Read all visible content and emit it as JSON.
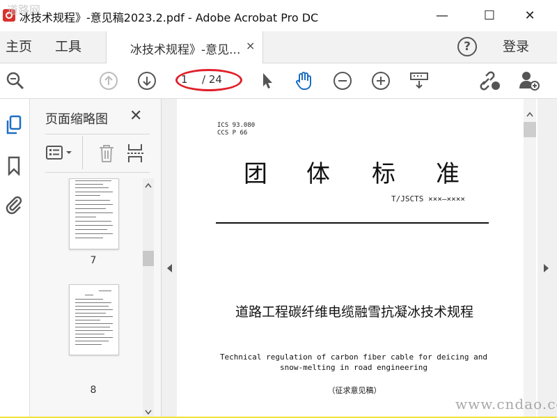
{
  "window": {
    "title": "冰技术规程》-意见稿2023.2.pdf - Adobe Acrobat Pro DC",
    "minimize": "—",
    "maximize": "☐",
    "close": "✕"
  },
  "menubar": {
    "home": "主页",
    "tools": "工具",
    "tab_label": "冰技术规程》-意见...",
    "tab_close": "×",
    "help": "?",
    "signin": "登录"
  },
  "toolbar": {
    "page_current": "1",
    "page_total": "/ 24"
  },
  "sidebar": {
    "panel_title": "页面缩略图",
    "panel_close": "✕",
    "thumbnails": [
      {
        "number": "7"
      },
      {
        "number": "8"
      }
    ]
  },
  "document": {
    "ics_line1": "ICS 93.080",
    "ics_line2": "CCS P 66",
    "big_chars": [
      "团",
      "体",
      "标",
      "准"
    ],
    "code": "T/JSCTS ×××—××××",
    "title_cn": "道路工程碳纤维电缆融雪抗凝冰技术规程",
    "title_en": "Technical regulation of carbon fiber cable for deicing and snow-melting in road engineering",
    "draft": "（征求意见稿）"
  },
  "watermark": {
    "bottom": "www.cndao.com",
    "top": "道路网"
  },
  "colors": {
    "highlight_oval": "#e0202a",
    "frame": "#f0e23c",
    "app_icon": "#d8322c",
    "hand_tool": "#1b6ec2"
  }
}
